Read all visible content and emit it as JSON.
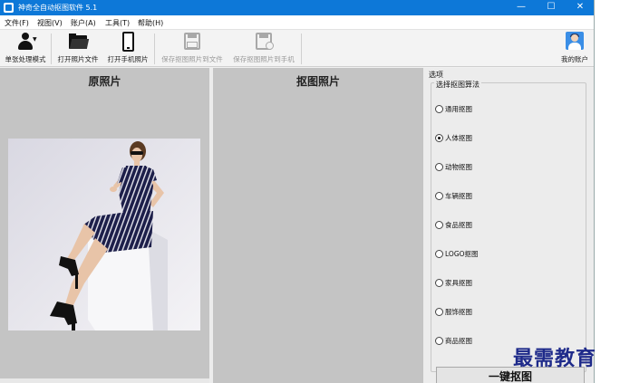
{
  "window": {
    "title": "神奇全自动抠图软件 5.1",
    "controls": {
      "minimize": "—",
      "maximize": "☐",
      "close": "✕"
    }
  },
  "menu": {
    "items": [
      "文件(F)",
      "视图(V)",
      "账户(A)",
      "工具(T)",
      "帮助(H)"
    ]
  },
  "toolbar": {
    "single_mode": "单张处理模式",
    "open_file": "打开照片文件",
    "open_phone": "打开手机照片",
    "save_file": "保存抠图照片到文件",
    "save_phone": "保存抠图照片到手机",
    "account": "我的账户"
  },
  "panels": {
    "original_title": "原照片",
    "cutout_title": "抠图照片"
  },
  "options": {
    "title": "选项",
    "group_label": "选择抠图算法",
    "selected": "人体抠图",
    "algorithms": [
      "通用抠图",
      "人体抠图",
      "动物抠图",
      "车辆抠图",
      "食品抠图",
      "LOGO抠图",
      "家具抠图",
      "服饰抠图",
      "商品抠图"
    ],
    "action_button": "一键抠图"
  },
  "watermark": "最需教育",
  "colors": {
    "titlebar": "#0d78d8",
    "panel_bg": "#c4c4c4",
    "watermark": "#1e2a8a"
  }
}
